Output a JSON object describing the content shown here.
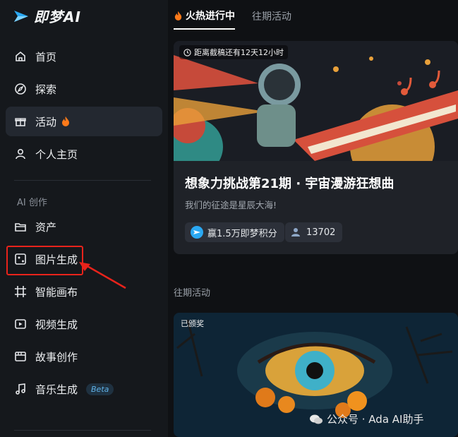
{
  "app": {
    "name": "即梦AI"
  },
  "sidebar": {
    "items": [
      {
        "label": "首页",
        "icon": "home-icon"
      },
      {
        "label": "探索",
        "icon": "compass-icon"
      },
      {
        "label": "活动",
        "icon": "gift-icon",
        "active": true
      },
      {
        "label": "个人主页",
        "icon": "user-icon"
      }
    ],
    "section_label": "AI 创作",
    "create_items": [
      {
        "label": "资产",
        "icon": "folder-icon"
      },
      {
        "label": "图片生成",
        "icon": "image-generate-icon"
      },
      {
        "label": "智能画布",
        "icon": "canvas-icon"
      },
      {
        "label": "视频生成",
        "icon": "video-generate-icon"
      },
      {
        "label": "故事创作",
        "icon": "story-icon"
      },
      {
        "label": "音乐生成",
        "icon": "music-icon",
        "badge": "Beta"
      }
    ]
  },
  "tabs": [
    {
      "label": "火热进行中",
      "active": true
    },
    {
      "label": "往期活动",
      "active": false
    }
  ],
  "featured": {
    "deadline": "距离截稿还有12天12小时",
    "title": "想象力挑战第21期 · 宇宙漫游狂想曲",
    "subtitle": "我们的征途是星辰大海!",
    "reward": "赢1.5万即梦积分",
    "participants": "13702"
  },
  "past": {
    "section_title": "往期活动",
    "status": "已颁奖"
  },
  "watermark": "公众号 · Ada AI助手",
  "colors": {
    "accent": "#2aa8f2",
    "highlight": "#e8231b",
    "fire": "#ff7a1a"
  }
}
